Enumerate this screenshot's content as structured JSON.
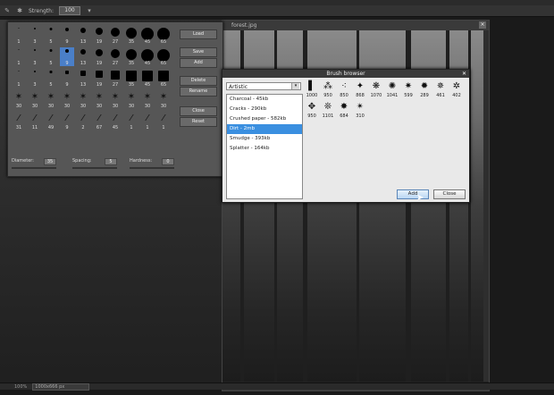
{
  "toolbar": {
    "label": "Strength:",
    "value": "100"
  },
  "image_window": {
    "title": "forest.jpg"
  },
  "brush_panel": {
    "rows": [
      [
        "1",
        "3",
        "5",
        "9",
        "13",
        "19",
        "27",
        "35",
        "45",
        "65"
      ],
      [
        "1",
        "3",
        "5",
        "9",
        "13",
        "19",
        "27",
        "35",
        "45",
        "65"
      ],
      [
        "1",
        "3",
        "5",
        "9",
        "13",
        "19",
        "27",
        "35",
        "45",
        "65"
      ],
      [
        "30",
        "30",
        "30",
        "30",
        "30",
        "30",
        "30",
        "30",
        "30",
        "30"
      ],
      [
        "31",
        "11",
        "49",
        "9",
        "2",
        "67",
        "45",
        "1",
        "1",
        "1"
      ]
    ],
    "buttons": [
      "Load",
      "Save",
      "Add",
      "Delete",
      "Rename",
      "Close",
      "Reset"
    ],
    "sliders": [
      {
        "label": "Diameter:",
        "value": "35"
      },
      {
        "label": "Spacing:",
        "value": "5"
      },
      {
        "label": "Hardness:",
        "value": "0"
      }
    ]
  },
  "dialog": {
    "title": "Brush browser",
    "category": "Artistic",
    "packs": [
      "Charcoal - 45kb",
      "Cracks - 290kb",
      "Crushed paper - 582kb",
      "Dirt - 2mb",
      "Smudge - 393kb",
      "Splatter - 164kb"
    ],
    "selected_index": 3,
    "thumbs_row1": [
      "1000",
      "950",
      "850",
      "868",
      "1070",
      "1041",
      "599",
      "289",
      "461",
      "402"
    ],
    "thumbs_row2": [
      "950",
      "1101",
      "684",
      "310"
    ],
    "add_label": "Add",
    "close_label": "Close"
  },
  "status": {
    "zoom": "100%",
    "info": "1000x666 px"
  }
}
